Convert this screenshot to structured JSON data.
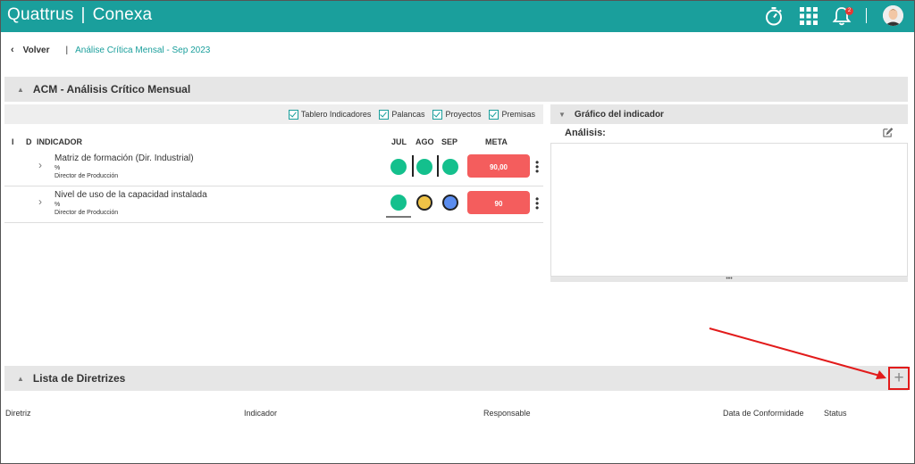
{
  "app": {
    "brand_left": "Quattrus",
    "brand_sep": "|",
    "brand_right": "Conexa",
    "notification_count": "2",
    "accent": "#1a9f9c"
  },
  "breadcrumb": {
    "back_label": "Volver",
    "separator": "|",
    "current": "Análise Crítica Mensal - Sep 2023"
  },
  "acm": {
    "title": "ACM - Análisis Crítico Mensual",
    "filters": [
      "Tablero Indicadores",
      "Palancas",
      "Proyectos",
      "Premisas"
    ],
    "columns": {
      "i": "I",
      "d": "D",
      "indicator": "INDICADOR",
      "m1": "JUL",
      "m2": "AGO",
      "m3": "SEP",
      "meta": "META"
    },
    "rows": [
      {
        "name": "Matriz de formación (Dir. Industrial)",
        "unit": "%",
        "owner": "Director de Producción",
        "meta": "90,00",
        "status": [
          "green",
          "green",
          "green"
        ]
      },
      {
        "name": "Nivel de uso de la capacidad instalada",
        "unit": "%",
        "owner": "Director de Producción",
        "meta": "90",
        "status": [
          "green",
          "yellow",
          "blue"
        ]
      }
    ],
    "status_colors": {
      "green": "#14c08d",
      "yellow": "#f0c347",
      "blue": "#5b8def",
      "meta_red": "#f45d5d"
    }
  },
  "grafico": {
    "title": "Gráfico del indicador",
    "analysis_label": "Análisis:",
    "resize_glyph": "•••"
  },
  "lista": {
    "title": "Lista de Diretrizes",
    "columns": [
      "Diretriz",
      "Indicador",
      "Responsable",
      "Data de Conformidade",
      "Status"
    ],
    "add_glyph": "+"
  }
}
